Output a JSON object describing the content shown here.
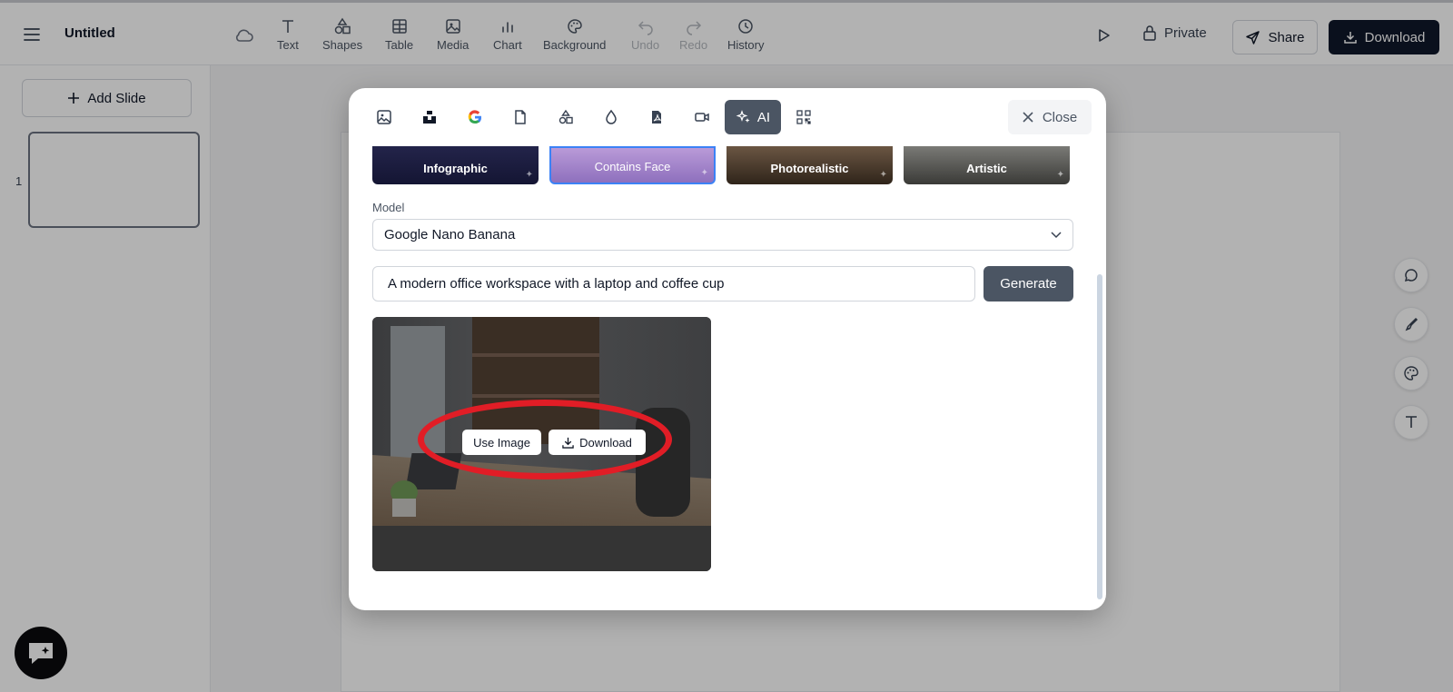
{
  "app": {
    "doc_title": "Untitled",
    "icons": {
      "menu": "menu-icon",
      "cloud": "cloud-icon"
    }
  },
  "toolbar": {
    "tools": [
      {
        "label": "Text",
        "icon": "text-icon",
        "enabled": true
      },
      {
        "label": "Shapes",
        "icon": "shapes-icon",
        "enabled": true
      },
      {
        "label": "Table",
        "icon": "table-icon",
        "enabled": true
      },
      {
        "label": "Media",
        "icon": "media-icon",
        "enabled": true
      },
      {
        "label": "Chart",
        "icon": "chart-icon",
        "enabled": true
      },
      {
        "label": "Background",
        "icon": "palette-icon",
        "enabled": true
      },
      {
        "label": "Undo",
        "icon": "undo-icon",
        "enabled": false
      },
      {
        "label": "Redo",
        "icon": "redo-icon",
        "enabled": false
      },
      {
        "label": "History",
        "icon": "history-icon",
        "enabled": true
      }
    ],
    "private_label": "Private",
    "share_label": "Share",
    "download_label": "Download"
  },
  "sidebar": {
    "add_slide_label": "Add Slide",
    "slides": [
      {
        "number": "1"
      }
    ]
  },
  "right_rail": {
    "buttons": [
      "comment-icon",
      "brush-icon",
      "palette-icon",
      "text-icon"
    ]
  },
  "modal": {
    "tabs": [
      {
        "icon": "image-icon"
      },
      {
        "icon": "unsplash-icon"
      },
      {
        "icon": "google-icon"
      },
      {
        "icon": "file-icon"
      },
      {
        "icon": "shapes-icon"
      },
      {
        "icon": "drop-icon"
      },
      {
        "icon": "pdf-icon"
      },
      {
        "icon": "video-icon"
      },
      {
        "icon": "sparkles-icon",
        "label": "AI",
        "active": true
      },
      {
        "icon": "qr-code-icon"
      }
    ],
    "close_label": "Close",
    "styles": [
      {
        "label": "Infographic"
      },
      {
        "label": "Contains Face",
        "selected": true
      },
      {
        "label": "Photorealistic"
      },
      {
        "label": "Artistic"
      }
    ],
    "model_label": "Model",
    "model_value": "Google Nano Banana",
    "prompt_value": "A modern office workspace with a laptop and coffee cup",
    "generate_label": "Generate",
    "image_actions": {
      "use_label": "Use Image",
      "download_label": "Download"
    }
  },
  "colors": {
    "primary_dark": "#0f172a",
    "active_tab": "#4b5563",
    "selected_border": "#3b82f6",
    "highlight": "#e11d26"
  }
}
